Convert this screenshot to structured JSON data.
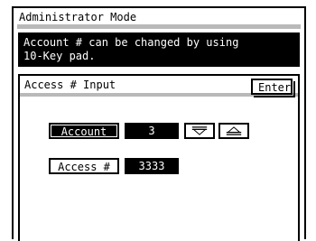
{
  "title": "Administrator Mode",
  "message": "Account # can be changed by using\n10-Key pad.",
  "section_title": "Access # Input",
  "enter_label": "Enter",
  "rows": [
    {
      "label": "Account #",
      "value": "3"
    },
    {
      "label": "Access #",
      "value": "3333"
    }
  ],
  "icons": {
    "down": "down-arrow-icon",
    "up": "up-arrow-icon"
  }
}
